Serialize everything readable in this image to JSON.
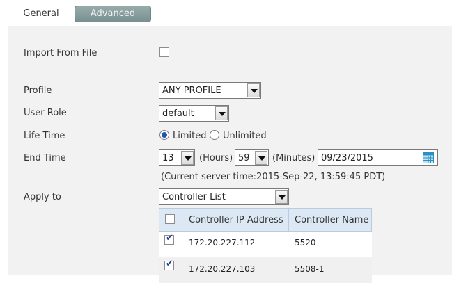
{
  "tabs": [
    {
      "label": "General",
      "active": false
    },
    {
      "label": "Advanced",
      "active": true
    }
  ],
  "form": {
    "import_label": "Import From File",
    "import_checked": false,
    "profile_label": "Profile",
    "profile_value": "ANY PROFILE",
    "role_label": "User Role",
    "role_value": "default",
    "lifetime_label": "Life Time",
    "lifetime_opt1": "Limited",
    "lifetime_opt2": "Unlimited",
    "lifetime_selected": "Limited",
    "endtime_label": "End Time",
    "hours_value": "13",
    "hours_label": "(Hours)",
    "minutes_value": "59",
    "minutes_label": "(Minutes)",
    "date_value": "09/23/2015",
    "server_time": "(Current server time:2015-Sep-22, 13:59:45 PDT)",
    "apply_label": "Apply to",
    "apply_value": "Controller List"
  },
  "controller_table": {
    "headers": [
      "Controller IP Address",
      "Controller Name"
    ],
    "rows": [
      {
        "ip": "172.20.227.112",
        "name": "5520",
        "checked": true
      },
      {
        "ip": "172.20.227.103",
        "name": "5508-1",
        "checked": true
      }
    ]
  },
  "colors": {
    "active_tab": "#84999a",
    "header_bg": "#dce8f3",
    "panel_bg": "#f2f2f2",
    "accent": "#1b56b5"
  }
}
